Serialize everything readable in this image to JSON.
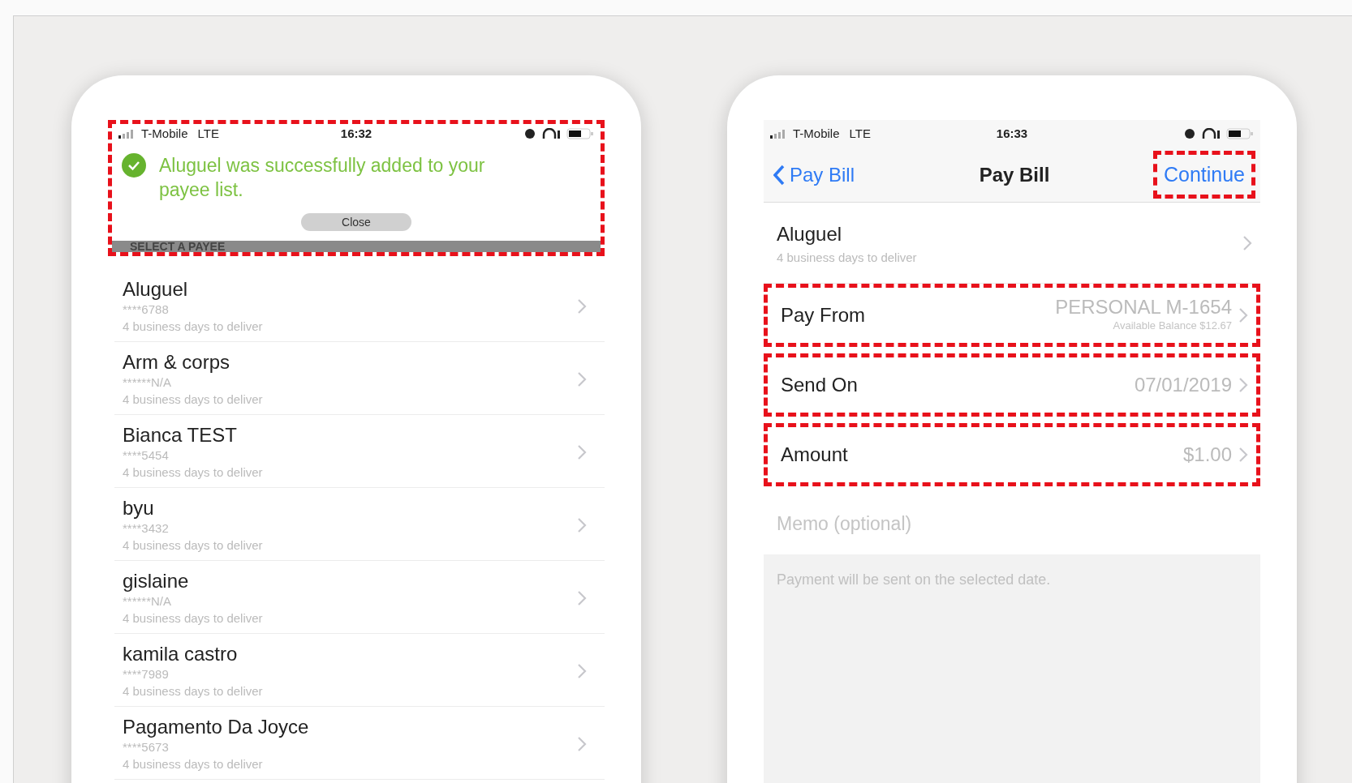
{
  "phones": [
    {
      "kind": "payee_list",
      "status_bar": {
        "carrier": "T-Mobile",
        "network": "LTE",
        "time": "16:32"
      },
      "toast": {
        "message": "Aluguel was successfully added to your payee list.",
        "button": "Close",
        "highlighted": true
      },
      "section_header": "SELECT A PAYEE",
      "payees": [
        {
          "name": "Aluguel",
          "account": "****6788",
          "delivery": "4 business days to deliver"
        },
        {
          "name": "Arm & corps",
          "account": "******N/A",
          "delivery": "4 business days to deliver"
        },
        {
          "name": "Bianca TEST",
          "account": "****5454",
          "delivery": "4 business days to deliver"
        },
        {
          "name": "byu",
          "account": "****3432",
          "delivery": "4 business days to deliver"
        },
        {
          "name": "gislaine",
          "account": "******N/A",
          "delivery": "4 business days to deliver"
        },
        {
          "name": "kamila castro",
          "account": "****7989",
          "delivery": "4 business days to deliver"
        },
        {
          "name": "Pagamento Da Joyce",
          "account": "****5673",
          "delivery": "4 business days to deliver"
        }
      ]
    },
    {
      "kind": "pay_bill",
      "status_bar": {
        "carrier": "T-Mobile",
        "network": "LTE",
        "time": "16:33"
      },
      "nav": {
        "back": "Pay Bill",
        "title": "Pay Bill",
        "action": {
          "label": "Continue",
          "highlighted": true
        }
      },
      "payee": {
        "name": "Aluguel",
        "delivery": "4 business days to deliver"
      },
      "fields": [
        {
          "label": "Pay From",
          "value": "PERSONAL M-1654",
          "note": "Available Balance $12.67",
          "highlighted": true
        },
        {
          "label": "Send On",
          "value": "07/01/2019",
          "highlighted": true
        },
        {
          "label": "Amount",
          "value": "$1.00",
          "highlighted": true
        }
      ],
      "memo": {
        "placeholder": "Memo (optional)"
      },
      "footer": "Payment will be sent on the selected date."
    }
  ]
}
